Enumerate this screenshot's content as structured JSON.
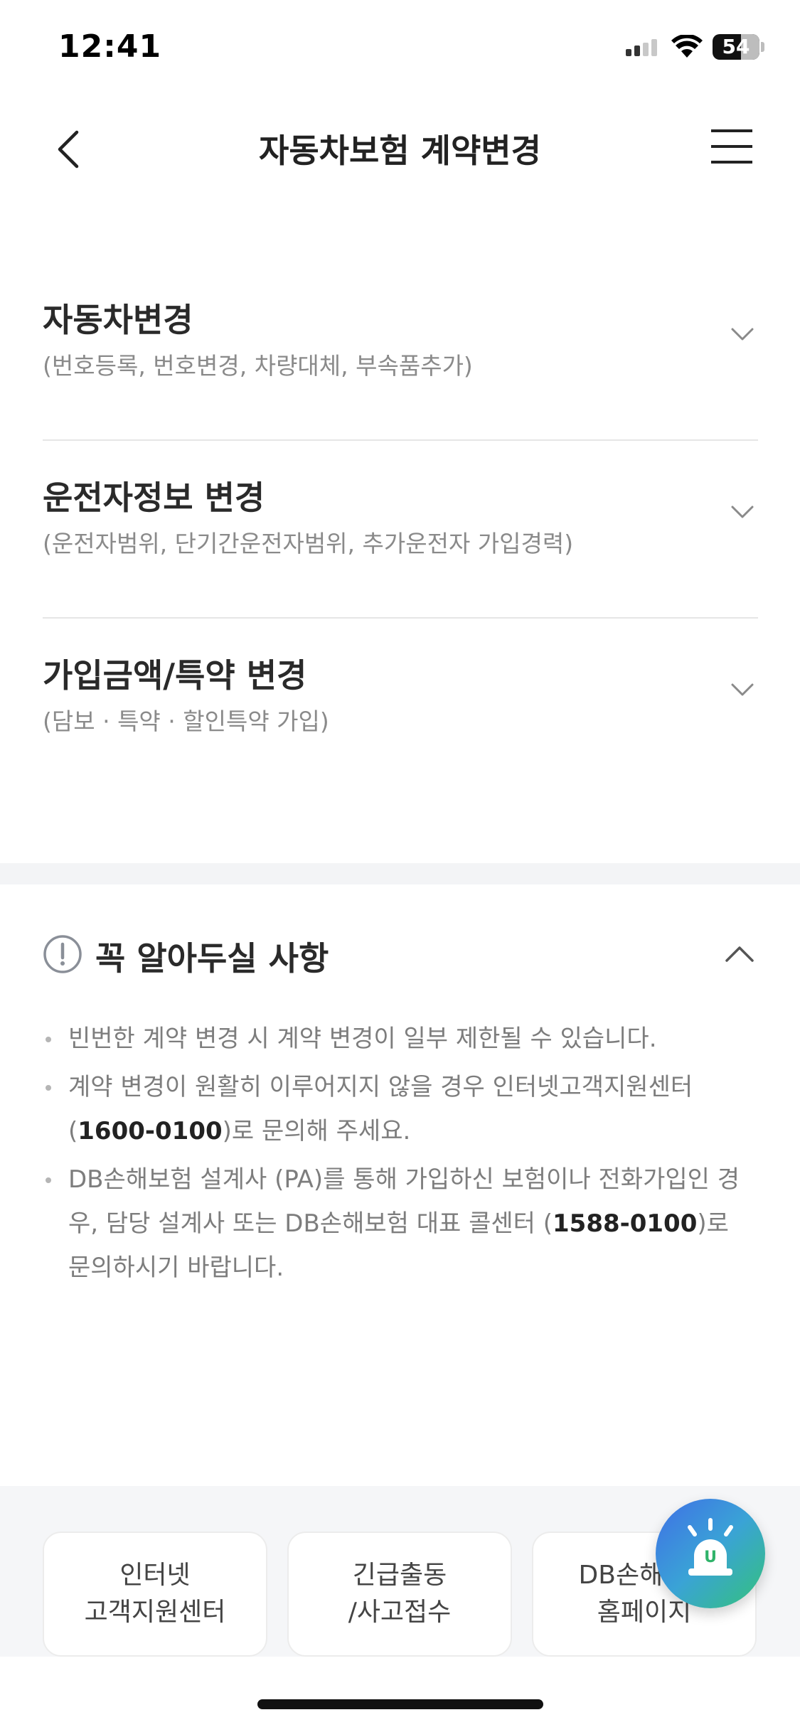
{
  "status_bar": {
    "time": "12:41",
    "battery": "54"
  },
  "header": {
    "title": "자동차보험 계약변경"
  },
  "sections": [
    {
      "title": "자동차변경",
      "subtitle": "(번호등록, 번호변경, 차량대체, 부속품추가)"
    },
    {
      "title": "운전자정보 변경",
      "subtitle": "(운전자범위, 단기간운전자범위, 추가운전자 가입경력)"
    },
    {
      "title": "가입금액/특약 변경",
      "subtitle": "(담보 · 특약 · 할인특약 가입)"
    }
  ],
  "notice": {
    "title": "꼭 알아두실 사항",
    "items": [
      {
        "pre": "빈번한 계약 변경 시 계약 변경이 일부 제한될 수 있습니다.",
        "bold": "",
        "post": ""
      },
      {
        "pre": "계약 변경이 원활히 이루어지지 않을 경우 인터넷고객지원센터 (",
        "bold": "1600-0100",
        "post": ")로 문의해 주세요."
      },
      {
        "pre": "DB손해보험 설계사 (PA)를 통해 가입하신 보험이나 전화가입인 경우, 담당 설계사 또는 DB손해보험 대표 콜센터 (",
        "bold": "1588-0100",
        "post": ")로 문의하시기 바랍니다."
      }
    ]
  },
  "quick_links": [
    {
      "line1": "인터넷",
      "line2": "고객지원센터"
    },
    {
      "line1": "긴급출동",
      "line2": "/사고접수"
    },
    {
      "line1": "DB손해보험",
      "line2": "홈페이지"
    }
  ],
  "fab": {
    "label": "U"
  },
  "icons": {
    "back": "chevron-left-icon",
    "menu": "hamburger-menu-icon",
    "expand": "chevron-down-icon",
    "collapse": "chevron-up-icon",
    "notice": "exclamation-circle-icon",
    "fab": "siren-icon"
  },
  "colors": {
    "fab_start": "#3f6fe6",
    "fab_end": "#34c27a",
    "text_primary": "#222222",
    "text_muted": "#8a8a8a"
  }
}
